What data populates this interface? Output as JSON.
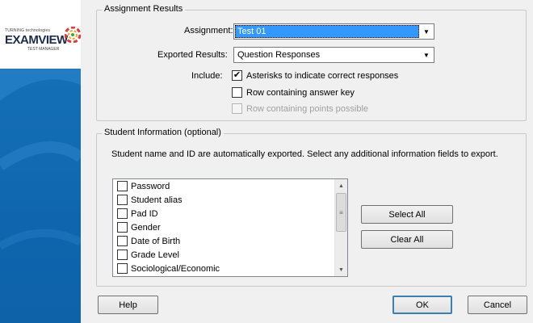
{
  "branding": {
    "small_text": "TURNING technologies",
    "logo_text": "EXAMVIEW",
    "sub_text": "TEST MANAGER"
  },
  "assignment_results": {
    "group_title": "Assignment Results",
    "assignment_label": "Assignment:",
    "assignment_value": "Test 01",
    "exported_label": "Exported Results:",
    "exported_value": "Question Responses",
    "include_label": "Include:",
    "options": [
      {
        "label": "Asterisks to indicate correct responses",
        "checked": true,
        "enabled": true
      },
      {
        "label": "Row containing answer key",
        "checked": false,
        "enabled": true
      },
      {
        "label": "Row containing points possible",
        "checked": false,
        "enabled": false
      }
    ]
  },
  "student_information": {
    "group_title": "Student Information (optional)",
    "description": "Student name and ID are automatically exported. Select any additional information fields to export.",
    "fields": [
      {
        "label": "Password",
        "checked": false
      },
      {
        "label": "Student alias",
        "checked": false
      },
      {
        "label": "Pad ID",
        "checked": false
      },
      {
        "label": "Gender",
        "checked": false
      },
      {
        "label": "Date of Birth",
        "checked": false
      },
      {
        "label": "Grade Level",
        "checked": false
      },
      {
        "label": "Sociological/Economic",
        "checked": false
      }
    ],
    "select_all_label": "Select All",
    "clear_all_label": "Clear All"
  },
  "footer": {
    "help_label": "Help",
    "ok_label": "OK",
    "cancel_label": "Cancel"
  },
  "colors": {
    "selection": "#3399ff",
    "sidebar_blue": "#1570b8",
    "default_button_border": "#3c7fb1"
  }
}
